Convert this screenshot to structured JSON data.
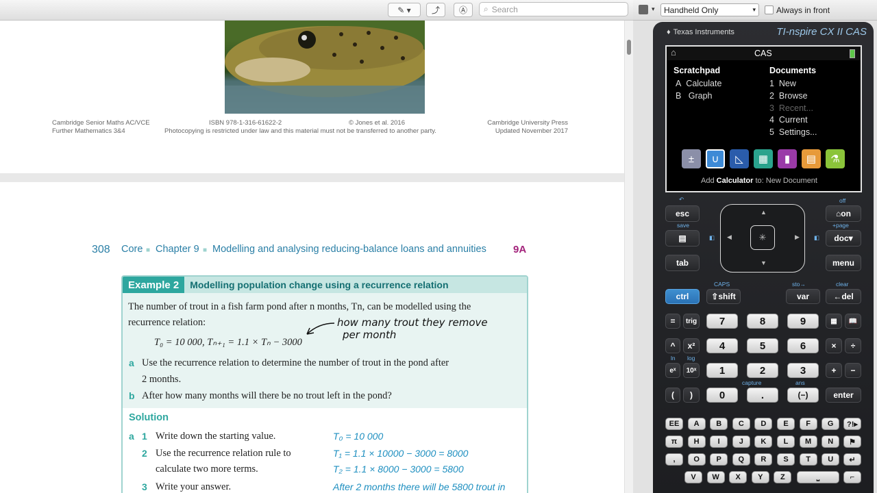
{
  "toolbar": {
    "search_placeholder": "Search"
  },
  "footer": {
    "left1": "Cambridge Senior Maths AC/VCE",
    "left2": "Further Mathematics 3&4",
    "isbn": "ISBN 978-1-316-61622-2",
    "copyright": "© Jones et al. 2016",
    "restrict": "Photocopying is restricted under law and this material must not be transferred to another party.",
    "publisher": "Cambridge University Press",
    "updated": "Updated November 2017"
  },
  "header": {
    "page": "308",
    "core": "Core",
    "chapter": "Chapter 9",
    "title": "Modelling and analysing reducing-balance loans and annuities",
    "section": "9A"
  },
  "example": {
    "num": "Example 2",
    "title": "Modelling population change using a recurrence relation",
    "intro1": "The number of trout in a fish farm pond after n months, Tn, can be modelled using the",
    "intro2": "recurrence relation:",
    "relation": "T₀ = 10 000, Tₙ₊₁ = 1.1 × Tₙ − 3000",
    "a_label": "a",
    "a_text1": "Use the recurrence relation to determine the number of trout in the pond after",
    "a_text2": "2 months.",
    "b_label": "b",
    "b_text": "After how many months will there be no trout left in the pond?",
    "solution": "Solution",
    "s_a": "a",
    "s1": "1",
    "s1_text": "Write down the starting value.",
    "s1_work": "T₀ = 10 000",
    "s2": "2",
    "s2_text1": "Use the recurrence relation rule to",
    "s2_text2": "calculate two more terms.",
    "s2_work1": "T₁ = 1.1 × 10000 − 3000 = 8000",
    "s2_work2": "T₂ = 1.1 × 8000 − 3000 = 5800",
    "s3": "3",
    "s3_text": "Write your answer.",
    "s3_work": "After 2 months there will be 5800 trout in",
    "handnote1": "how many trout they remove",
    "handnote2": "per month"
  },
  "right_toolbar": {
    "mode": "Handheld Only",
    "always_front": "Always in front"
  },
  "calc": {
    "brand": "Texas Instruments",
    "model": "TI-nspire CX II CAS",
    "screen": {
      "title": "CAS",
      "scratchpad": "Scratchpad",
      "a": "A",
      "calculate": "Calculate",
      "b": "B",
      "graph": "Graph",
      "documents": "Documents",
      "n1": "1",
      "new": "New",
      "n2": "2",
      "browse": "Browse",
      "n3": "3",
      "recent": "Recent...",
      "n4": "4",
      "current": "Current",
      "n5": "5",
      "settings": "Settings...",
      "status_add": "Add",
      "status_calc": "Calculator",
      "status_to": "to: New Document"
    },
    "keys": {
      "esc": "esc",
      "on": "on",
      "doc": "doc",
      "tab": "tab",
      "menu": "menu",
      "ctrl": "ctrl",
      "shift": "shift",
      "var": "var",
      "del": "del",
      "eq": "=",
      "trig": "trig",
      "k7": "7",
      "k8": "8",
      "k9": "9",
      "hat": "^",
      "x2": "x²",
      "k4": "4",
      "k5": "5",
      "k6": "6",
      "times": "×",
      "div": "÷",
      "ex": "eˣ",
      "tenx": "10ˣ",
      "k1": "1",
      "k2": "2",
      "k3": "3",
      "plus": "+",
      "minus": "−",
      "lp": "(",
      "rp": ")",
      "k0": "0",
      "dot": ".",
      "neg": "(−)",
      "enter": "enter",
      "ee": "EE",
      "alpha": [
        "A",
        "B",
        "C",
        "D",
        "E",
        "F",
        "G",
        "H",
        "I",
        "J",
        "K",
        "L",
        "M",
        "N",
        "O",
        "P",
        "Q",
        "R",
        "S",
        "T",
        "U",
        "V",
        "W",
        "X",
        "Y",
        "Z"
      ],
      "pi": "π",
      "comma": ","
    },
    "subs": {
      "off": "off",
      "save": "save",
      "page": "+page",
      "caps": "CAPS",
      "sto": "sto→",
      "clear": "clear",
      "ln": "ln",
      "log": "log",
      "capture": "capture",
      "ans": "ans"
    }
  }
}
